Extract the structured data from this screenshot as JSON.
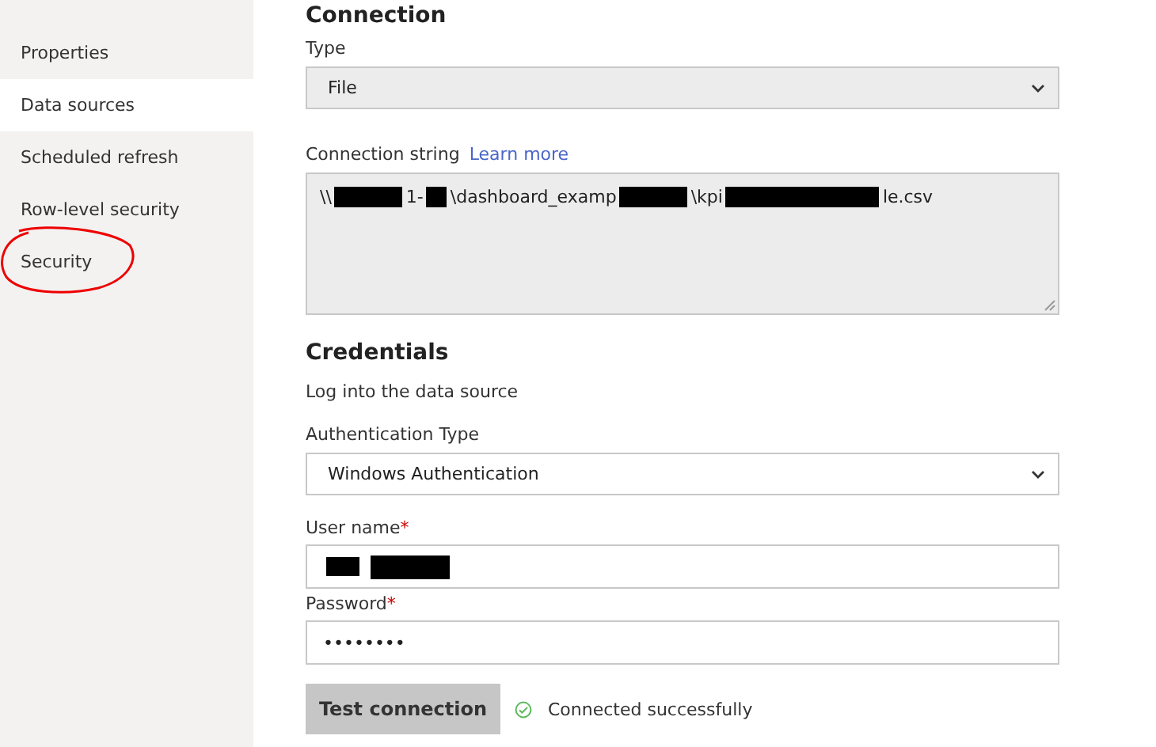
{
  "sidebar": {
    "items": [
      {
        "label": "Properties",
        "selected": false,
        "annotated": false
      },
      {
        "label": "Data sources",
        "selected": true,
        "annotated": false
      },
      {
        "label": "Scheduled refresh",
        "selected": false,
        "annotated": false
      },
      {
        "label": "Row-level security",
        "selected": false,
        "annotated": false
      },
      {
        "label": "Security",
        "selected": false,
        "annotated": true
      }
    ]
  },
  "connection": {
    "heading": "Connection",
    "type_label": "Type",
    "type_value": "File",
    "string_label": "Connection string",
    "learn_more": "Learn more",
    "string_parts": [
      {
        "kind": "text",
        "text": "\\\\"
      },
      {
        "kind": "redacted"
      },
      {
        "kind": "text",
        "text": "1-"
      },
      {
        "kind": "redacted"
      },
      {
        "kind": "text",
        "text": "\\dashboard_examp"
      },
      {
        "kind": "redacted"
      },
      {
        "kind": "text",
        "text": "\\kpi"
      },
      {
        "kind": "redacted"
      },
      {
        "kind": "text",
        "text": "le.csv"
      }
    ]
  },
  "credentials": {
    "heading": "Credentials",
    "subtitle": "Log into the data source",
    "auth_label": "Authentication Type",
    "auth_value": "Windows Authentication",
    "username_label": "User name",
    "username_parts": [
      {
        "kind": "redacted"
      },
      {
        "kind": "redacted"
      }
    ],
    "password_label": "Password",
    "password_value": "••••••••",
    "required_mark": "*",
    "test_button": "Test connection",
    "status": "Connected successfully",
    "connected": true
  }
}
